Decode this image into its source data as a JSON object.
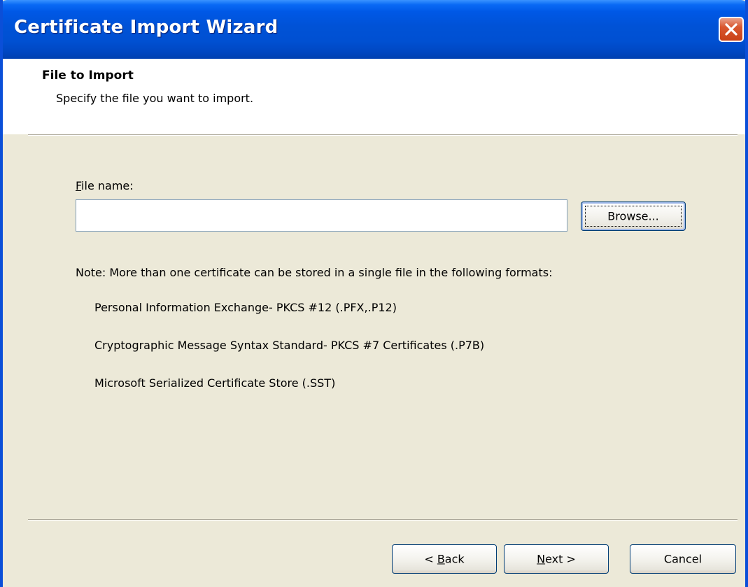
{
  "window": {
    "title": "Certificate Import Wizard",
    "close_icon": "close-icon",
    "colors": {
      "titlebar": "#0058e6",
      "close_button": "#d9572f",
      "dialog_background": "#ece9d8",
      "header_background": "#ffffff"
    }
  },
  "header": {
    "title": "File to Import",
    "subtitle": "Specify the file you want to import."
  },
  "file": {
    "label_mnemonic": "F",
    "label_rest": "ile name:",
    "value": "",
    "browse_label": "Browse..."
  },
  "note": {
    "text": "Note:  More than one certificate can be stored in a single file in the following formats:",
    "formats": [
      "Personal Information Exchange- PKCS #12 (.PFX,.P12)",
      "Cryptographic Message Syntax Standard- PKCS #7 Certificates (.P7B)",
      "Microsoft Serialized Certificate Store (.SST)"
    ]
  },
  "footer": {
    "back_prefix": "< ",
    "back_mnemonic": "B",
    "back_rest": "ack",
    "next_mnemonic": "N",
    "next_rest": "ext >",
    "cancel_label": "Cancel"
  }
}
